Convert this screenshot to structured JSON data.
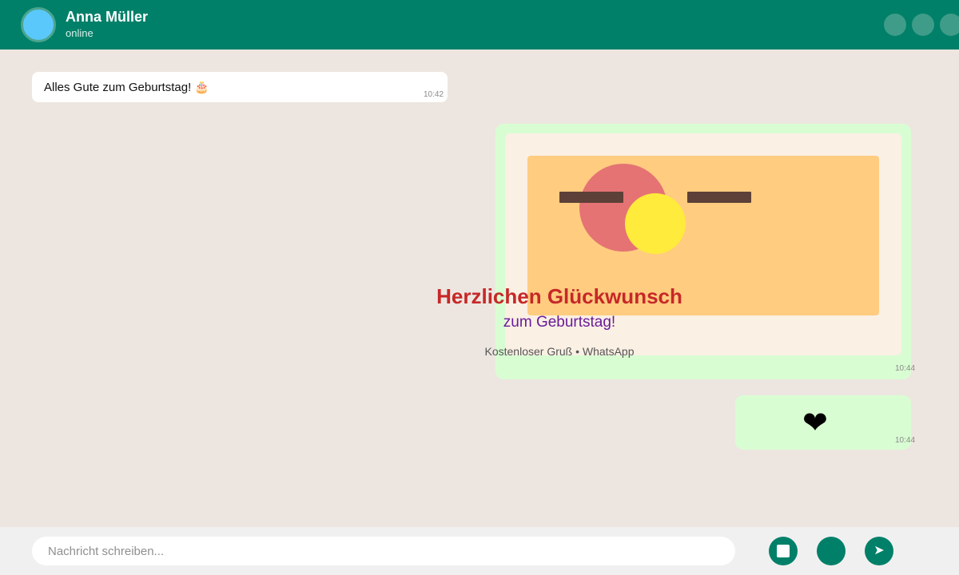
{
  "header": {
    "contact_name": "Anna Müller",
    "status": "online",
    "icons": [
      "video-call-icon",
      "voice-call-icon",
      "menu-icon"
    ]
  },
  "messages": [
    {
      "direction": "incoming",
      "text": "Alles Gute zum Geburtstag! 🎂",
      "time": "10:42"
    },
    {
      "direction": "outgoing",
      "type": "greeting-card",
      "title": "Herzlichen Glückwunsch",
      "subtitle": "zum Geburtstag!",
      "footer": "Kostenloser Gruß • WhatsApp",
      "time": "10:44"
    },
    {
      "direction": "outgoing",
      "text": "❤",
      "time": "10:44"
    }
  ],
  "composer": {
    "placeholder": "Nachricht schreiben...",
    "icons": [
      "sticker-icon",
      "mic-icon",
      "send-icon"
    ]
  },
  "colors": {
    "header": "#008069",
    "chat_background": "#ede6e0",
    "outgoing_bubble": "#d9fdd3",
    "incoming_bubble": "#ffffff",
    "card_title": "#c62828",
    "card_subtitle": "#6a1b9a"
  }
}
